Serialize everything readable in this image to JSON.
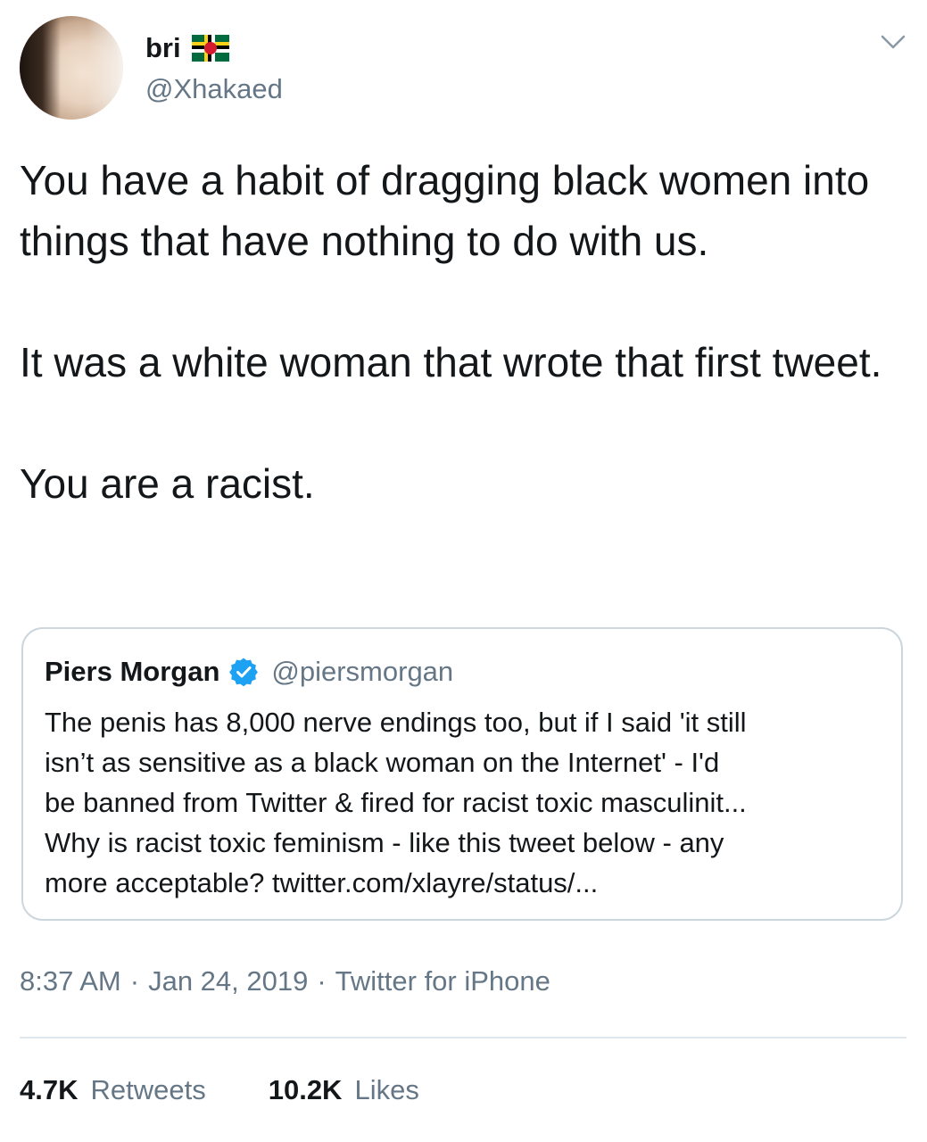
{
  "author": {
    "display_name": "bri",
    "handle": "@Xhakaed",
    "flag_icon": "dominica-flag-icon",
    "avatar_icon": "profile-photo"
  },
  "tweet": {
    "paragraphs": [
      "You have a habit of dragging black women into things that have nothing to do with us.",
      "It was a white woman that wrote that first tweet.",
      "You are a racist."
    ]
  },
  "quoted_tweet": {
    "display_name": "Piers Morgan",
    "verified_icon": "verified-badge-icon",
    "handle": "@piersmorgan",
    "lines": [
      "The penis has 8,000 nerve endings too, but if I said 'it still",
      "isn’t as sensitive as a black woman on the Internet' - I'd",
      "be banned from Twitter & fired for racist toxic masculinit...",
      "Why is racist toxic feminism - like this tweet below - any",
      "more acceptable? twitter.com/xlayre/status/..."
    ]
  },
  "meta": {
    "time": "8:37 AM",
    "separator": "·",
    "date": "Jan 24, 2019",
    "source": "Twitter for iPhone"
  },
  "stats": {
    "retweets_count": "4.7K",
    "retweets_label": "Retweets",
    "likes_count": "10.2K",
    "likes_label": "Likes"
  },
  "colors": {
    "text": "#14171a",
    "secondary": "#657786",
    "border": "#ccd6dd",
    "verified": "#1da1f2"
  },
  "menu_icon": "chevron-down-icon"
}
